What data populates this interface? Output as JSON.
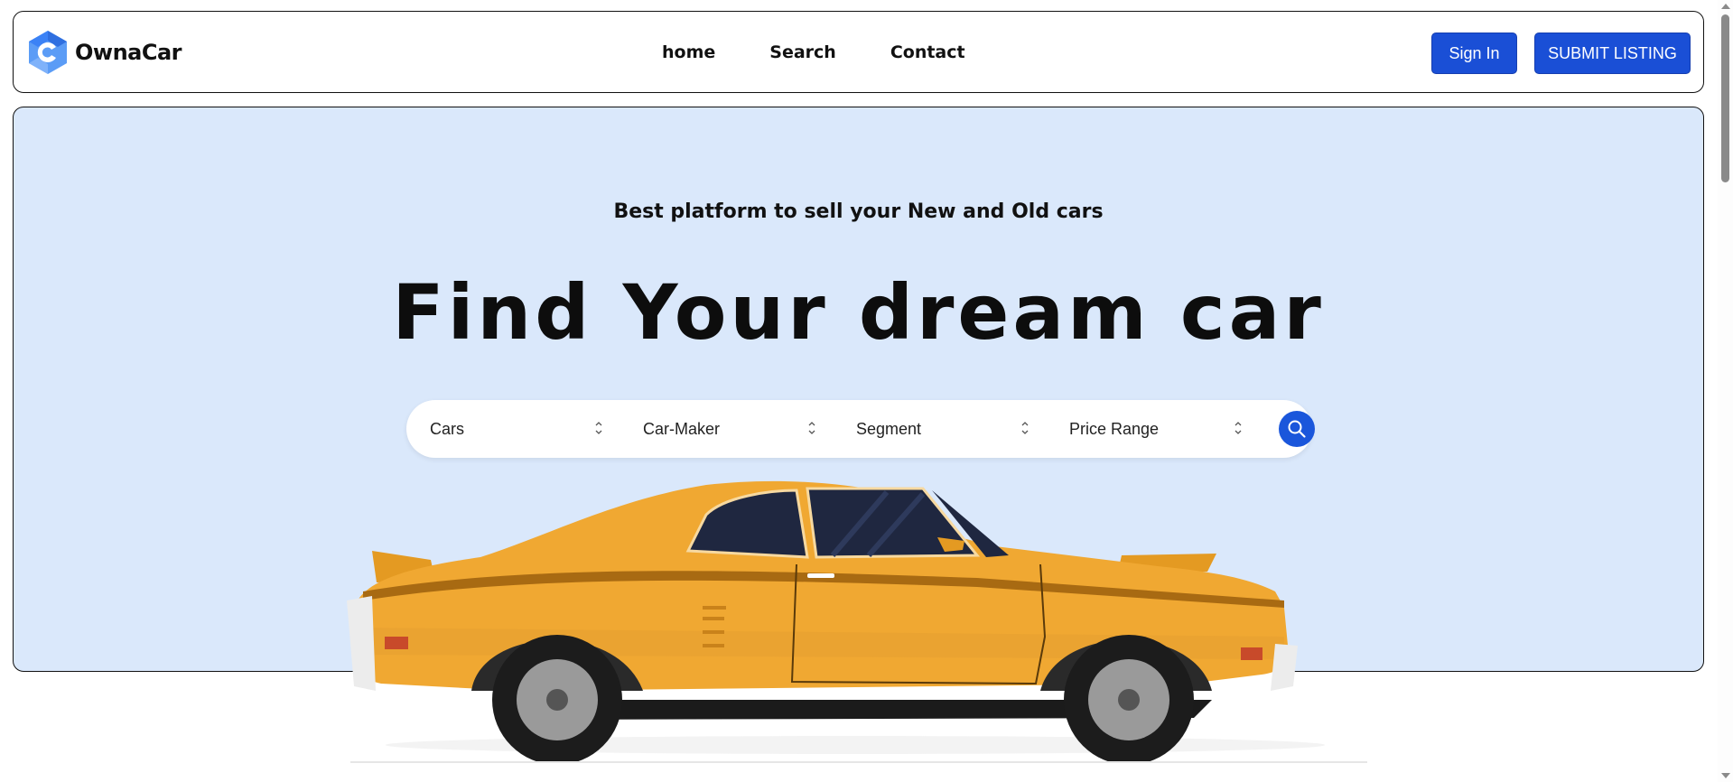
{
  "brand": {
    "name": "OwnaCar",
    "logo_icon": "hexagon-c-logo",
    "color": "#3b82f6"
  },
  "nav": {
    "items": [
      {
        "label": "home"
      },
      {
        "label": "Search"
      },
      {
        "label": "Contact"
      }
    ]
  },
  "header_actions": {
    "sign_in": "Sign In",
    "submit": "SUBMIT LISTING",
    "accent": "#1a4fd6"
  },
  "hero": {
    "tagline": "Best platform to sell your New and Old cars",
    "headline": "Find Your dream car",
    "background": "#dae8fb"
  },
  "search": {
    "filters": [
      {
        "label": "Cars",
        "icon": "chevron-updown-icon"
      },
      {
        "label": "Car-Maker",
        "icon": "chevron-updown-icon"
      },
      {
        "label": "Segment",
        "icon": "chevron-updown-icon"
      },
      {
        "label": "Price Range",
        "icon": "chevron-updown-icon"
      }
    ],
    "button_icon": "search-icon"
  },
  "illustration": {
    "name": "yellow-muscle-car",
    "body_color": "#f0a832"
  }
}
